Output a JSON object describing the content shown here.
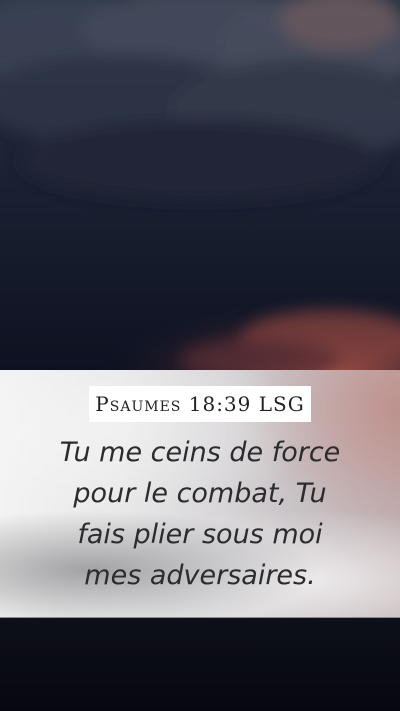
{
  "reference": "Psaumes 18:39 LSG",
  "verse": {
    "lines": [
      "Tu me ceins de force",
      "pour le combat, Tu",
      "fais plier sous moi",
      "mes adversaires."
    ]
  },
  "colors": {
    "sky_top": "#2a3344",
    "sky_bottom": "#0a0d18",
    "sunset_glow": "#b0574a",
    "band_light": "#f3f3f3",
    "text": "#2c2c2e"
  }
}
